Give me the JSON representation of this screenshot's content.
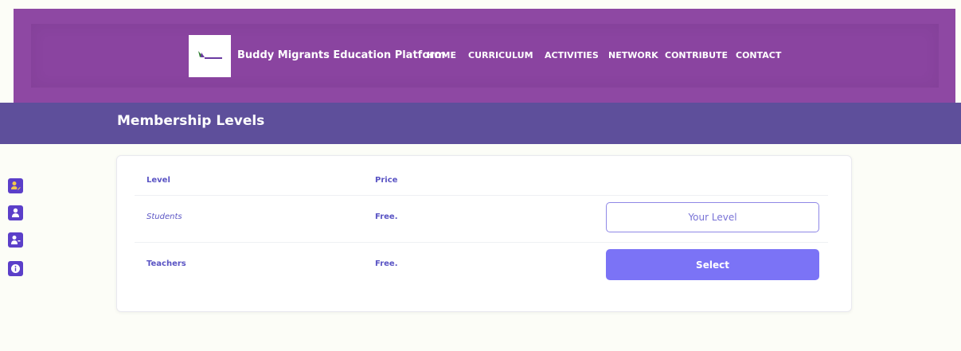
{
  "header": {
    "brand": "Buddy Migrants Education Platform",
    "nav": [
      "HOME",
      "CURRICULUM",
      "ACTIVITIES",
      "NETWORK",
      "CONTRIBUTE",
      "CONTACT"
    ]
  },
  "page": {
    "title": "Membership Levels"
  },
  "table": {
    "headers": {
      "level": "Level",
      "price": "Price"
    },
    "rows": [
      {
        "level": "Students",
        "price": "Free.",
        "action": "Your Level"
      },
      {
        "level": "Teachers",
        "price": "Free.",
        "action": "Select"
      }
    ]
  },
  "sidebar": {
    "icons": [
      "user-edit-icon",
      "user-icon",
      "user-minus-icon",
      "info-icon"
    ]
  },
  "colors": {
    "header": "#8e48a3",
    "band": "#5e4f9b",
    "accent": "#7b73f6",
    "text": "#5a54c4"
  }
}
